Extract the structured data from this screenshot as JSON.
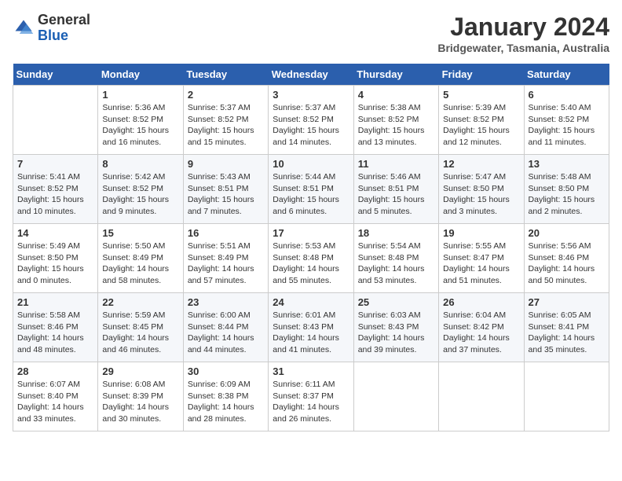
{
  "header": {
    "logo_general": "General",
    "logo_blue": "Blue",
    "month_title": "January 2024",
    "location": "Bridgewater, Tasmania, Australia"
  },
  "weekdays": [
    "Sunday",
    "Monday",
    "Tuesday",
    "Wednesday",
    "Thursday",
    "Friday",
    "Saturday"
  ],
  "weeks": [
    [
      {
        "day": "",
        "sunrise": "",
        "sunset": "",
        "daylight": ""
      },
      {
        "day": "1",
        "sunrise": "Sunrise: 5:36 AM",
        "sunset": "Sunset: 8:52 PM",
        "daylight": "Daylight: 15 hours and 16 minutes."
      },
      {
        "day": "2",
        "sunrise": "Sunrise: 5:37 AM",
        "sunset": "Sunset: 8:52 PM",
        "daylight": "Daylight: 15 hours and 15 minutes."
      },
      {
        "day": "3",
        "sunrise": "Sunrise: 5:37 AM",
        "sunset": "Sunset: 8:52 PM",
        "daylight": "Daylight: 15 hours and 14 minutes."
      },
      {
        "day": "4",
        "sunrise": "Sunrise: 5:38 AM",
        "sunset": "Sunset: 8:52 PM",
        "daylight": "Daylight: 15 hours and 13 minutes."
      },
      {
        "day": "5",
        "sunrise": "Sunrise: 5:39 AM",
        "sunset": "Sunset: 8:52 PM",
        "daylight": "Daylight: 15 hours and 12 minutes."
      },
      {
        "day": "6",
        "sunrise": "Sunrise: 5:40 AM",
        "sunset": "Sunset: 8:52 PM",
        "daylight": "Daylight: 15 hours and 11 minutes."
      }
    ],
    [
      {
        "day": "7",
        "sunrise": "Sunrise: 5:41 AM",
        "sunset": "Sunset: 8:52 PM",
        "daylight": "Daylight: 15 hours and 10 minutes."
      },
      {
        "day": "8",
        "sunrise": "Sunrise: 5:42 AM",
        "sunset": "Sunset: 8:52 PM",
        "daylight": "Daylight: 15 hours and 9 minutes."
      },
      {
        "day": "9",
        "sunrise": "Sunrise: 5:43 AM",
        "sunset": "Sunset: 8:51 PM",
        "daylight": "Daylight: 15 hours and 7 minutes."
      },
      {
        "day": "10",
        "sunrise": "Sunrise: 5:44 AM",
        "sunset": "Sunset: 8:51 PM",
        "daylight": "Daylight: 15 hours and 6 minutes."
      },
      {
        "day": "11",
        "sunrise": "Sunrise: 5:46 AM",
        "sunset": "Sunset: 8:51 PM",
        "daylight": "Daylight: 15 hours and 5 minutes."
      },
      {
        "day": "12",
        "sunrise": "Sunrise: 5:47 AM",
        "sunset": "Sunset: 8:50 PM",
        "daylight": "Daylight: 15 hours and 3 minutes."
      },
      {
        "day": "13",
        "sunrise": "Sunrise: 5:48 AM",
        "sunset": "Sunset: 8:50 PM",
        "daylight": "Daylight: 15 hours and 2 minutes."
      }
    ],
    [
      {
        "day": "14",
        "sunrise": "Sunrise: 5:49 AM",
        "sunset": "Sunset: 8:50 PM",
        "daylight": "Daylight: 15 hours and 0 minutes."
      },
      {
        "day": "15",
        "sunrise": "Sunrise: 5:50 AM",
        "sunset": "Sunset: 8:49 PM",
        "daylight": "Daylight: 14 hours and 58 minutes."
      },
      {
        "day": "16",
        "sunrise": "Sunrise: 5:51 AM",
        "sunset": "Sunset: 8:49 PM",
        "daylight": "Daylight: 14 hours and 57 minutes."
      },
      {
        "day": "17",
        "sunrise": "Sunrise: 5:53 AM",
        "sunset": "Sunset: 8:48 PM",
        "daylight": "Daylight: 14 hours and 55 minutes."
      },
      {
        "day": "18",
        "sunrise": "Sunrise: 5:54 AM",
        "sunset": "Sunset: 8:48 PM",
        "daylight": "Daylight: 14 hours and 53 minutes."
      },
      {
        "day": "19",
        "sunrise": "Sunrise: 5:55 AM",
        "sunset": "Sunset: 8:47 PM",
        "daylight": "Daylight: 14 hours and 51 minutes."
      },
      {
        "day": "20",
        "sunrise": "Sunrise: 5:56 AM",
        "sunset": "Sunset: 8:46 PM",
        "daylight": "Daylight: 14 hours and 50 minutes."
      }
    ],
    [
      {
        "day": "21",
        "sunrise": "Sunrise: 5:58 AM",
        "sunset": "Sunset: 8:46 PM",
        "daylight": "Daylight: 14 hours and 48 minutes."
      },
      {
        "day": "22",
        "sunrise": "Sunrise: 5:59 AM",
        "sunset": "Sunset: 8:45 PM",
        "daylight": "Daylight: 14 hours and 46 minutes."
      },
      {
        "day": "23",
        "sunrise": "Sunrise: 6:00 AM",
        "sunset": "Sunset: 8:44 PM",
        "daylight": "Daylight: 14 hours and 44 minutes."
      },
      {
        "day": "24",
        "sunrise": "Sunrise: 6:01 AM",
        "sunset": "Sunset: 8:43 PM",
        "daylight": "Daylight: 14 hours and 41 minutes."
      },
      {
        "day": "25",
        "sunrise": "Sunrise: 6:03 AM",
        "sunset": "Sunset: 8:43 PM",
        "daylight": "Daylight: 14 hours and 39 minutes."
      },
      {
        "day": "26",
        "sunrise": "Sunrise: 6:04 AM",
        "sunset": "Sunset: 8:42 PM",
        "daylight": "Daylight: 14 hours and 37 minutes."
      },
      {
        "day": "27",
        "sunrise": "Sunrise: 6:05 AM",
        "sunset": "Sunset: 8:41 PM",
        "daylight": "Daylight: 14 hours and 35 minutes."
      }
    ],
    [
      {
        "day": "28",
        "sunrise": "Sunrise: 6:07 AM",
        "sunset": "Sunset: 8:40 PM",
        "daylight": "Daylight: 14 hours and 33 minutes."
      },
      {
        "day": "29",
        "sunrise": "Sunrise: 6:08 AM",
        "sunset": "Sunset: 8:39 PM",
        "daylight": "Daylight: 14 hours and 30 minutes."
      },
      {
        "day": "30",
        "sunrise": "Sunrise: 6:09 AM",
        "sunset": "Sunset: 8:38 PM",
        "daylight": "Daylight: 14 hours and 28 minutes."
      },
      {
        "day": "31",
        "sunrise": "Sunrise: 6:11 AM",
        "sunset": "Sunset: 8:37 PM",
        "daylight": "Daylight: 14 hours and 26 minutes."
      },
      {
        "day": "",
        "sunrise": "",
        "sunset": "",
        "daylight": ""
      },
      {
        "day": "",
        "sunrise": "",
        "sunset": "",
        "daylight": ""
      },
      {
        "day": "",
        "sunrise": "",
        "sunset": "",
        "daylight": ""
      }
    ]
  ]
}
